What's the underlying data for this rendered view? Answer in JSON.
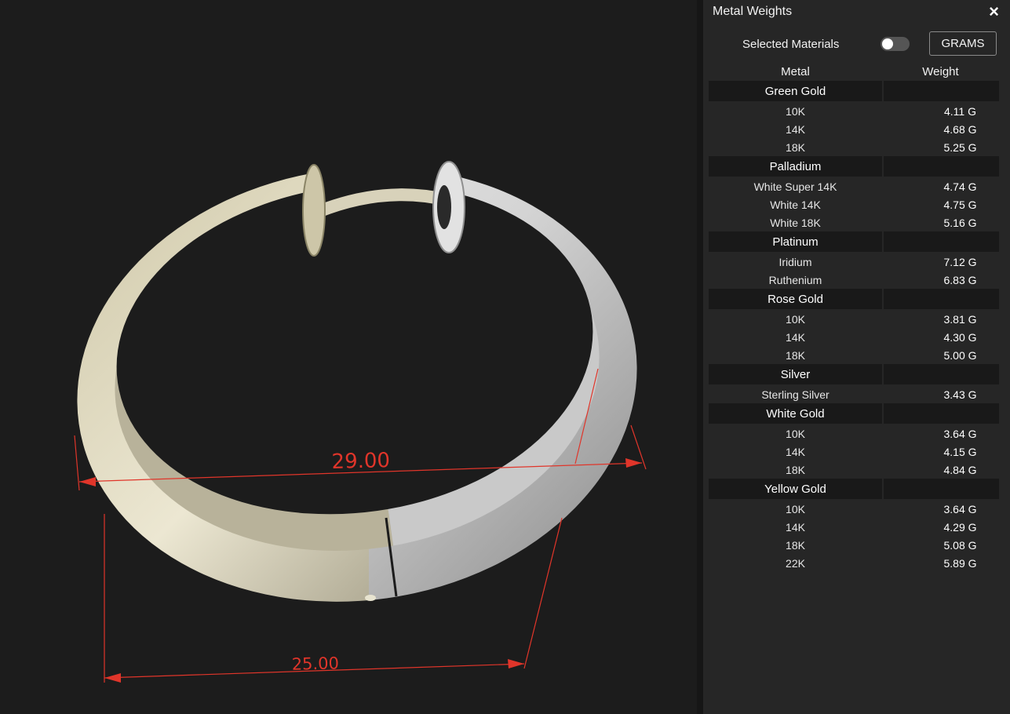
{
  "viewport": {
    "dimensions": [
      "29.00",
      "25.00"
    ],
    "colors": {
      "gold": "#d7d1b6",
      "silver": "#e6e6e6",
      "dimension": "#e0352a"
    }
  },
  "panel": {
    "title": "Metal Weights",
    "close_icon": "×",
    "selected_materials_label": "Selected Materials",
    "selected_materials_on": false,
    "unit_button": "GRAMS",
    "columns": {
      "metal": "Metal",
      "weight": "Weight"
    },
    "groups": [
      {
        "name": "Green Gold",
        "items": [
          {
            "name": "10K",
            "weight": "4.11 G"
          },
          {
            "name": "14K",
            "weight": "4.68 G"
          },
          {
            "name": "18K",
            "weight": "5.25 G"
          }
        ]
      },
      {
        "name": "Palladium",
        "items": [
          {
            "name": "White Super 14K",
            "weight": "4.74 G"
          },
          {
            "name": "White 14K",
            "weight": "4.75 G"
          },
          {
            "name": "White 18K",
            "weight": "5.16 G"
          }
        ]
      },
      {
        "name": "Platinum",
        "items": [
          {
            "name": "Iridium",
            "weight": "7.12 G"
          },
          {
            "name": "Ruthenium",
            "weight": "6.83 G"
          }
        ]
      },
      {
        "name": "Rose Gold",
        "items": [
          {
            "name": "10K",
            "weight": "3.81 G"
          },
          {
            "name": "14K",
            "weight": "4.30 G"
          },
          {
            "name": "18K",
            "weight": "5.00 G"
          }
        ]
      },
      {
        "name": "Silver",
        "items": [
          {
            "name": "Sterling Silver",
            "weight": "3.43 G"
          }
        ]
      },
      {
        "name": "White Gold",
        "items": [
          {
            "name": "10K",
            "weight": "3.64 G"
          },
          {
            "name": "14K",
            "weight": "4.15 G"
          },
          {
            "name": "18K",
            "weight": "4.84 G"
          }
        ]
      },
      {
        "name": "Yellow Gold",
        "items": [
          {
            "name": "10K",
            "weight": "3.64 G"
          },
          {
            "name": "14K",
            "weight": "4.29 G"
          },
          {
            "name": "18K",
            "weight": "5.08 G"
          },
          {
            "name": "22K",
            "weight": "5.89 G"
          }
        ]
      }
    ]
  }
}
